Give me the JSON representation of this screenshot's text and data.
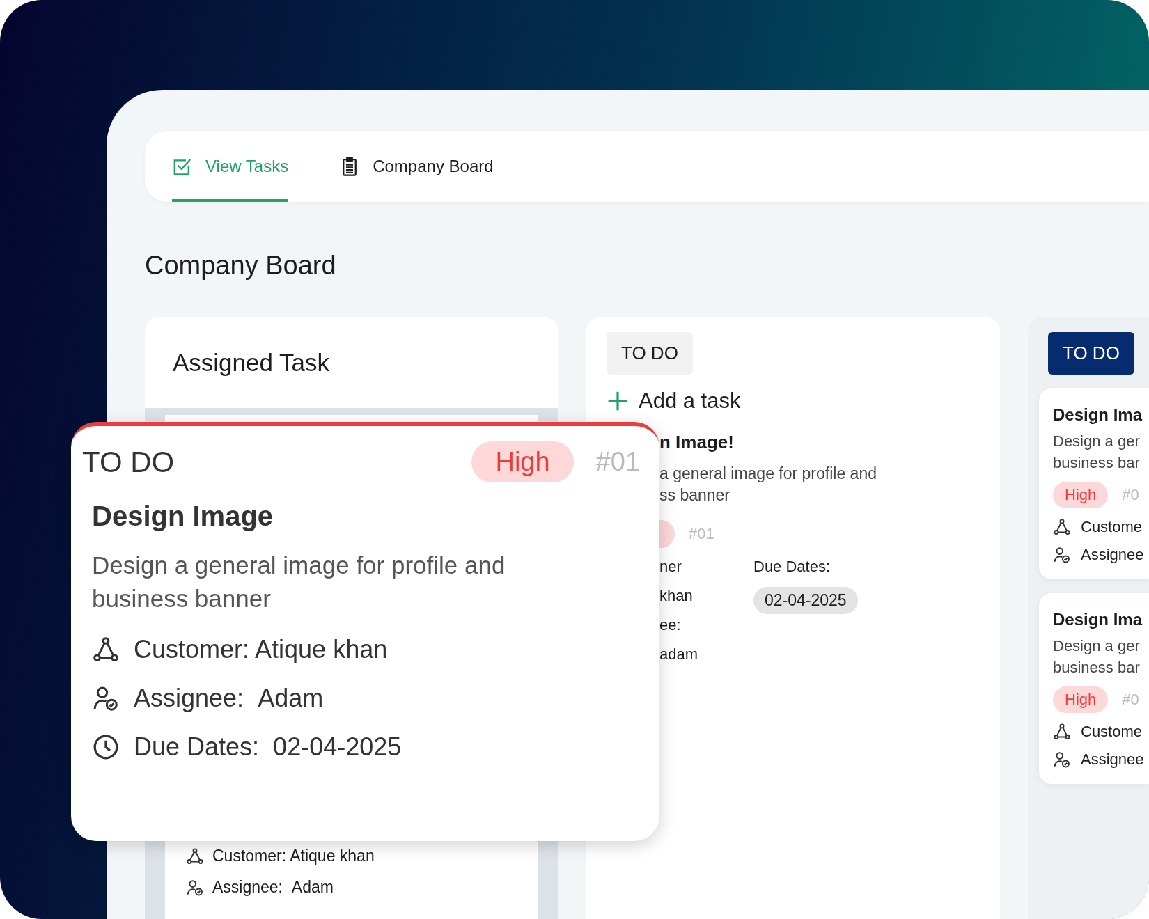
{
  "tabs": [
    {
      "label": "View Tasks",
      "selected": true
    },
    {
      "label": "Company Board",
      "selected": false
    }
  ],
  "page_title": "Company Board",
  "assigned_column": {
    "title": "Assigned Task",
    "card": {
      "customer_label": "Customer:",
      "customer": "Atique khan",
      "assignee_label": "Assignee:",
      "assignee": "Adam"
    }
  },
  "todo_column": {
    "status": "TO DO",
    "add_task": "Add a task",
    "task": {
      "title": "n Image!",
      "description_lines": [
        "a general image for profile and",
        "ss banner"
      ],
      "number": "#01",
      "fields": [
        {
          "label": "ner",
          "value": "khan"
        },
        {
          "label": "ee:",
          "value": "adam"
        }
      ],
      "due_label": "Due Dates:",
      "due": "02-04-2025"
    }
  },
  "board_column": {
    "status": "TO DO",
    "cards": [
      {
        "title": "Design Ima",
        "description_lines": [
          "Design a ger",
          "business bar"
        ],
        "priority": "High",
        "number": "#0",
        "customer_label": "Custome",
        "assignee_label": "Assignee"
      },
      {
        "title": "Design Ima",
        "description_lines": [
          "Design a ger",
          "business bar"
        ],
        "priority": "High",
        "number": "#0",
        "customer_label": "Custome",
        "assignee_label": "Assignee"
      }
    ]
  },
  "overlay_card": {
    "status": "TO DO",
    "priority": "High",
    "number": "#01",
    "title": "Design Image",
    "description": "Design a general image for profile and business banner",
    "customer_label": "Customer:",
    "customer": "Atique khan",
    "assignee_label": "Assignee:",
    "assignee": "Adam",
    "due_label": "Due Dates:",
    "due": "02-04-2025"
  }
}
